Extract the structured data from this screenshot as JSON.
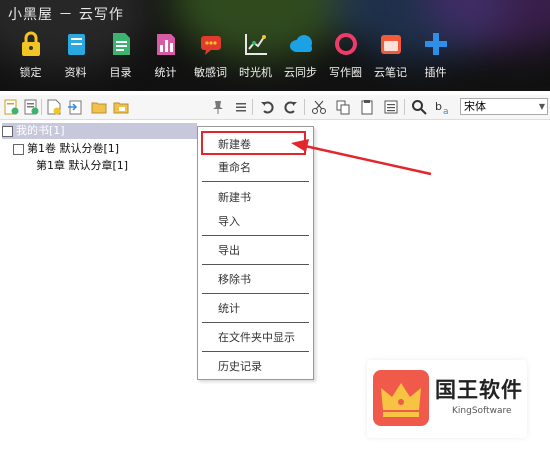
{
  "window": {
    "title": "小黑屋 － 云写作"
  },
  "toolbar": [
    {
      "label": "锁定",
      "icon": "lock-icon",
      "color": "#f3c524"
    },
    {
      "label": "资料",
      "icon": "book-icon",
      "color": "#2aa9e0"
    },
    {
      "label": "目录",
      "icon": "document-icon",
      "color": "#3cb371"
    },
    {
      "label": "统计",
      "icon": "bar-chart-icon",
      "color": "#d65aa6"
    },
    {
      "label": "敏感词",
      "icon": "speech-bubble-icon",
      "color": "#e23b2e"
    },
    {
      "label": "时光机",
      "icon": "line-chart-icon",
      "color": "#e8e8e8"
    },
    {
      "label": "云同步",
      "icon": "cloud-icon",
      "color": "#1aa1e6"
    },
    {
      "label": "写作圈",
      "icon": "ring-icon",
      "color": "#f03a6a"
    },
    {
      "label": "云笔记",
      "icon": "notebook-icon",
      "color": "#f15a3a"
    },
    {
      "label": "插件",
      "icon": "plus-icon",
      "color": "#2f8ee5"
    }
  ],
  "edit_toolbar": {
    "font_value": "宋体",
    "icons": [
      "new-book-icon",
      "new-volume-icon",
      "new-chapter-icon",
      "import-icon",
      "folder-icon",
      "folder-star-icon",
      "pin-icon",
      "list-icon",
      "undo-icon",
      "redo-icon",
      "cut-icon",
      "copy-icon",
      "paste-icon",
      "format-icon",
      "search-icon",
      "replace-icon"
    ]
  },
  "tree": {
    "book": "我的书[1]",
    "volume": "第1卷 默认分卷[1]",
    "chapter": "第1章 默认分章[1]"
  },
  "context_menu": {
    "items": [
      "新建卷",
      "重命名",
      "新建书",
      "导入",
      "导出",
      "移除书",
      "统计",
      "在文件夹中显示",
      "历史记录"
    ]
  },
  "watermark": {
    "name": "国王软件",
    "sub": "KingSoftware"
  },
  "accent": "#e3262b"
}
